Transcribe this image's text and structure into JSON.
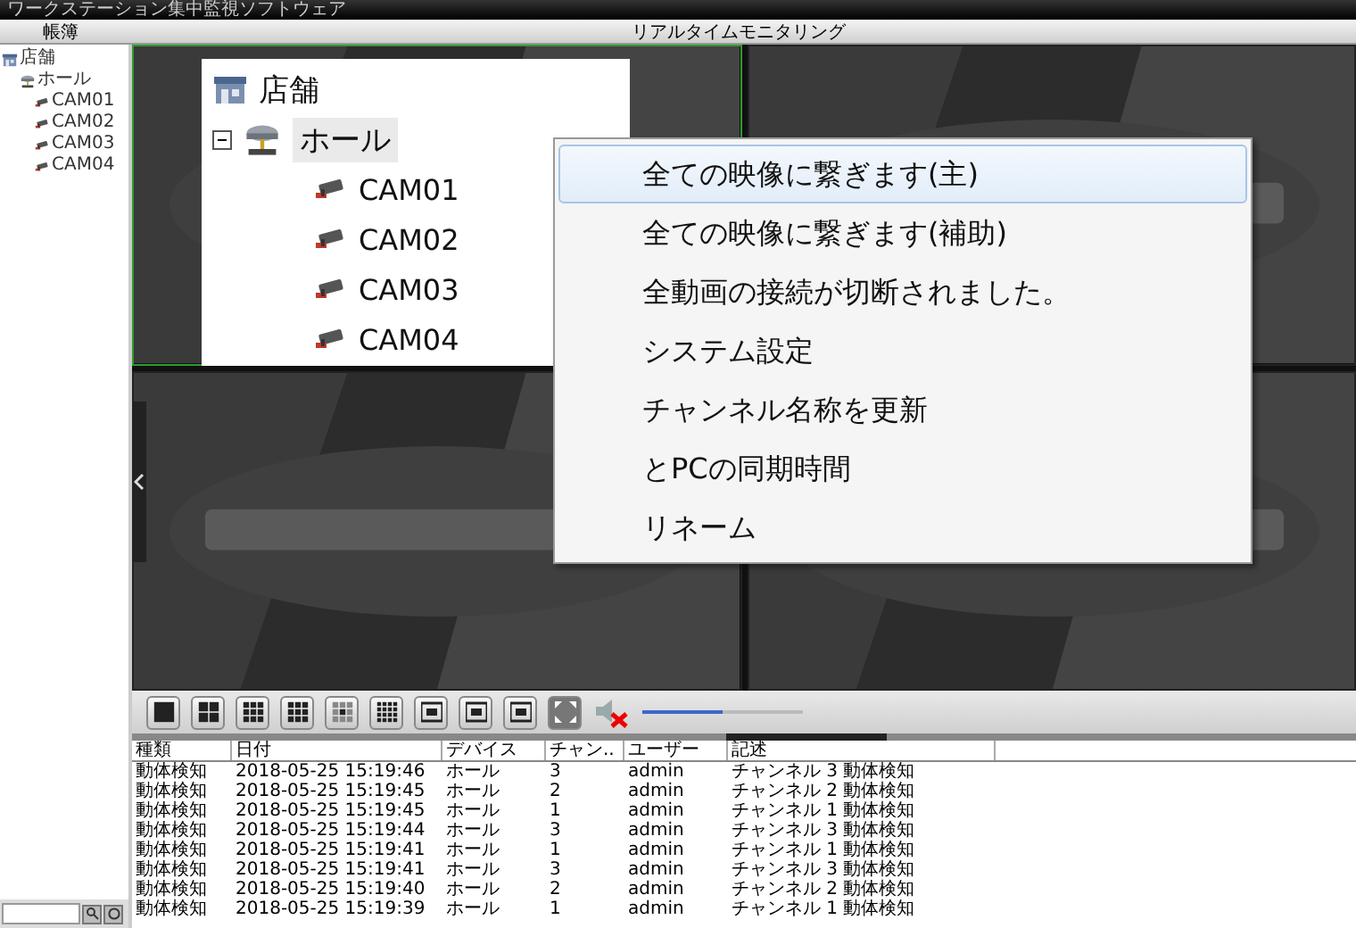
{
  "window": {
    "title": "ワークステーション集中監視ソフトウェア"
  },
  "header": {
    "left_label": "帳簿",
    "center_label": "リアルタイムモニタリング"
  },
  "sidebar": {
    "tree": [
      {
        "label": "店舗",
        "kind": "store",
        "children": [
          {
            "label": "ホール",
            "kind": "hub",
            "children": [
              {
                "label": "CAM01",
                "kind": "camera"
              },
              {
                "label": "CAM02",
                "kind": "camera"
              },
              {
                "label": "CAM03",
                "kind": "camera"
              },
              {
                "label": "CAM04",
                "kind": "camera"
              }
            ]
          }
        ]
      }
    ]
  },
  "video_tiles": [
    {
      "kind": "picture",
      "selected": true
    },
    {
      "kind": "picture",
      "selected": false
    },
    {
      "kind": "picture",
      "selected": false
    },
    {
      "kind": "picture",
      "selected": false
    }
  ],
  "device_tree": {
    "root": {
      "label": "店舗",
      "kind": "store"
    },
    "group": {
      "label": "ホール",
      "kind": "hub",
      "expanded": true,
      "selected": true
    },
    "items": [
      {
        "label": "CAM01",
        "kind": "camera"
      },
      {
        "label": "CAM02",
        "kind": "camera"
      },
      {
        "label": "CAM03",
        "kind": "camera"
      },
      {
        "label": "CAM04",
        "kind": "camera"
      }
    ]
  },
  "context_menu": [
    {
      "label": "全ての映像に繋ぎます(主)",
      "selected": true
    },
    {
      "label": "全ての映像に繋ぎます(補助)",
      "selected": false
    },
    {
      "label": "全動画の接続が切断されました。",
      "selected": false
    },
    {
      "label": "システム設定",
      "selected": false
    },
    {
      "label": "チャンネル名称を更新",
      "selected": false
    },
    {
      "label": "とPCの同期時間",
      "selected": false
    },
    {
      "label": "リネーム",
      "selected": false
    }
  ],
  "volume": {
    "muted": true,
    "level": 0.5
  },
  "log_table": {
    "columns": [
      "種類",
      "日付",
      "デバイス",
      "チャン..",
      "ユーザー",
      "記述"
    ],
    "rows": [
      [
        "動体検知",
        "2018-05-25 15:19:46",
        "ホール",
        "3",
        "admin",
        "チャンネル 3 動体検知"
      ],
      [
        "動体検知",
        "2018-05-25 15:19:45",
        "ホール",
        "2",
        "admin",
        "チャンネル 2 動体検知"
      ],
      [
        "動体検知",
        "2018-05-25 15:19:45",
        "ホール",
        "1",
        "admin",
        "チャンネル 1 動体検知"
      ],
      [
        "動体検知",
        "2018-05-25 15:19:44",
        "ホール",
        "3",
        "admin",
        "チャンネル 3 動体検知"
      ],
      [
        "動体検知",
        "2018-05-25 15:19:41",
        "ホール",
        "1",
        "admin",
        "チャンネル 1 動体検知"
      ],
      [
        "動体検知",
        "2018-05-25 15:19:41",
        "ホール",
        "3",
        "admin",
        "チャンネル 3 動体検知"
      ],
      [
        "動体検知",
        "2018-05-25 15:19:40",
        "ホール",
        "2",
        "admin",
        "チャンネル 2 動体検知"
      ],
      [
        "動体検知",
        "2018-05-25 15:19:39",
        "ホール",
        "1",
        "admin",
        "チャンネル 1 動体検知"
      ]
    ]
  }
}
